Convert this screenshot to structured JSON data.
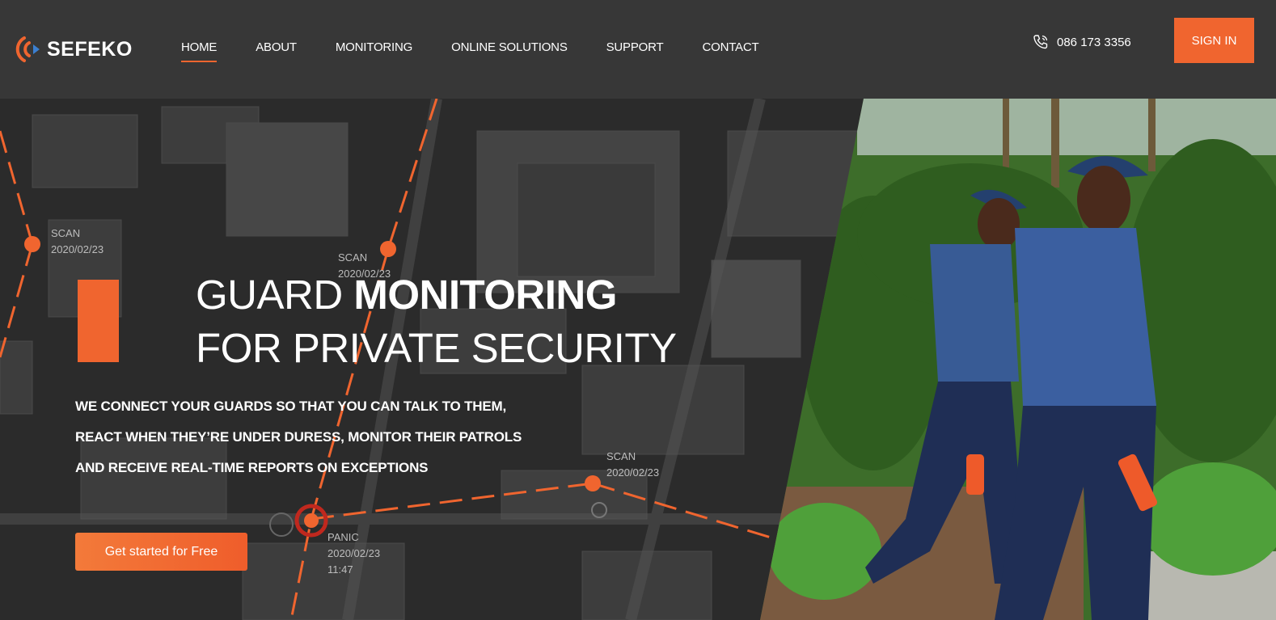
{
  "brand": {
    "name": "SEFEKO",
    "accent_color": "#f0652f",
    "header_bg": "#373737"
  },
  "nav": {
    "items": [
      {
        "label": "HOME",
        "active": true
      },
      {
        "label": "ABOUT",
        "active": false
      },
      {
        "label": "MONITORING",
        "active": false
      },
      {
        "label": "ONLINE SOLUTIONS",
        "active": false
      },
      {
        "label": "SUPPORT",
        "active": false
      },
      {
        "label": "CONTACT",
        "active": false
      }
    ]
  },
  "header": {
    "phone_icon": "phone-icon",
    "phone": "086 173 3356",
    "sign_in_label": "SIGN IN"
  },
  "hero": {
    "headline_part1": "GUARD ",
    "headline_bold": "MONITORING",
    "headline_line2": "FOR PRIVATE SECURITY",
    "subtext_lines": [
      "WE CONNECT YOUR GUARDS SO THAT YOU CAN TALK TO THEM,",
      "REACT WHEN THEY’RE UNDER DURESS, MONITOR THEIR PATROLS",
      "AND RECEIVE REAL-TIME REPORTS ON EXCEPTIONS"
    ],
    "cta_label": "Get started for Free",
    "map_points": [
      {
        "type": "SCAN",
        "date": "2020/02/23",
        "time": ""
      },
      {
        "type": "SCAN",
        "date": "2020/02/23",
        "time": ""
      },
      {
        "type": "SCAN",
        "date": "2020/02/23",
        "time": ""
      },
      {
        "type": "PANIC",
        "date": "2020/02/23",
        "time": "11:47"
      }
    ]
  }
}
